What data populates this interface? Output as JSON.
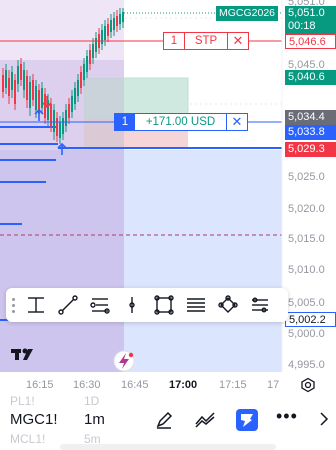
{
  "price_axis": {
    "labels": [
      "5,045.0",
      "5,025.0",
      "5,020.0",
      "5,015.0",
      "5,010.0",
      "5,005.0",
      "5,000.0",
      "4,995.0"
    ],
    "top_partial": "5,051.0"
  },
  "symbol_tag": {
    "text": "MGCG2026",
    "price": "5,051.0",
    "countdown": "00:18",
    "color": "#089981"
  },
  "stop_order": {
    "qty": "1",
    "label": "STP",
    "price": "5,046.6",
    "color": "#f23645"
  },
  "tp_line": {
    "price": "5,040.6",
    "color": "#089981"
  },
  "position": {
    "qty": "1",
    "pnl": "+171.00 USD",
    "entry_price": "5,034.4",
    "mark_price": "5,033.8",
    "color": "#2962ff"
  },
  "alert_line": {
    "price": "5,029.3",
    "color": "#f23645"
  },
  "horizontal_line": {
    "price": "5,002.2"
  },
  "time_axis": {
    "labels": [
      "16:15",
      "16:30",
      "16:45",
      "17:00",
      "17:15",
      "17"
    ],
    "bold_label": "17:00"
  },
  "bottom_bar": {
    "symbol": "MGC1!",
    "interval": "1m",
    "ghost_above_symbol": "PL1!",
    "ghost_above_interval": "1D",
    "ghost_below_symbol": "MCL1!",
    "ghost_below_interval": "5m"
  },
  "drawing_toolbar": {
    "tools": [
      "measure-tool-icon",
      "trend-line-icon",
      "fib-retracement-icon",
      "vertical-line-icon",
      "rectangle-icon",
      "parallel-channel-icon",
      "path-icon",
      "more-tools-icon"
    ]
  },
  "brand": {
    "logo": "TV"
  },
  "colors": {
    "up": "#089981",
    "down": "#f23645",
    "accent": "#2962ff",
    "selection": "#e1d4f2",
    "blue_zone": "#dbe5fd"
  }
}
